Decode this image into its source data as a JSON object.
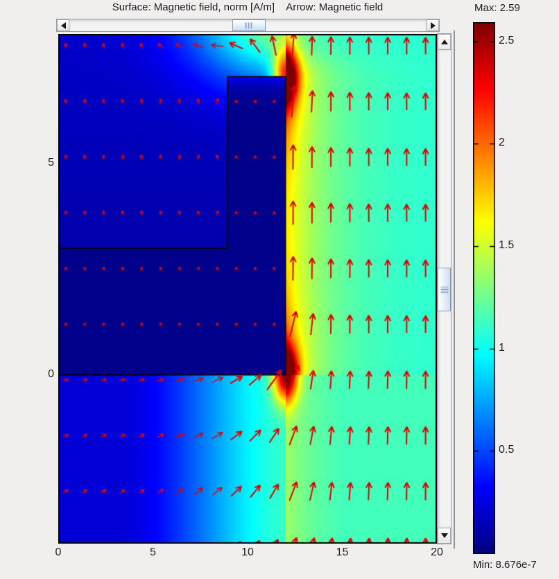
{
  "title": {
    "surface": "Surface: Magnetic field, norm [A/m]",
    "arrow": "Arrow: Magnetic field"
  },
  "colorbar": {
    "max_label": "Max: 2.59",
    "min_label": "Min: 8.676e-7",
    "vmin": 0,
    "vmax": 2.59,
    "tick_values": [
      2.5,
      2,
      1.5,
      1,
      0.5
    ],
    "tick_labels": [
      "2.5",
      "2",
      "1.5",
      "1",
      "0.5"
    ],
    "colormap": "jet"
  },
  "axes": {
    "x_range": [
      0,
      20
    ],
    "y_range": [
      -4.0,
      8.08
    ],
    "x_ticks": [
      0,
      5,
      10,
      15,
      20
    ],
    "x_tick_labels": [
      "0",
      "5",
      "10",
      "15",
      "20"
    ],
    "y_ticks": [
      5,
      0
    ],
    "y_tick_labels": [
      "5",
      "0"
    ]
  },
  "chart_data": {
    "type": "heatmap",
    "subtype": "surface-with-quiver",
    "quantity": "Magnetic field, norm [A/m]",
    "arrow_quantity": "Magnetic field",
    "colormap": "jet",
    "value_max": 2.59,
    "value_min": 8.676e-07,
    "background_field_level": 1.08,
    "core_field_level": 0.03,
    "geometry_outline": [
      [
        0,
        3
      ],
      [
        8.93,
        3
      ],
      [
        8.93,
        7.07
      ],
      [
        12,
        7.07
      ],
      [
        12,
        0
      ],
      [
        0,
        0
      ]
    ],
    "hotspots": [
      {
        "x": 12,
        "y": 7.07,
        "value": 2.59
      },
      {
        "x": 12,
        "y": 0,
        "value": 2.59
      }
    ],
    "sample_x": [
      1,
      5,
      9,
      11,
      13,
      16,
      20
    ],
    "sample_y": [
      8,
      7,
      5,
      3,
      1,
      -1,
      -4
    ],
    "sample_values": [
      [
        0.3,
        0.42,
        0.78,
        1.15,
        1.3,
        1.12,
        1.03
      ],
      [
        0.25,
        0.3,
        0.05,
        0.05,
        1.95,
        1.2,
        1.05
      ],
      [
        0.14,
        0.15,
        0.05,
        0.05,
        1.55,
        1.2,
        1.06
      ],
      [
        0.12,
        0.13,
        0.05,
        0.05,
        1.45,
        1.18,
        1.06
      ],
      [
        0.05,
        0.05,
        0.05,
        0.05,
        1.5,
        1.18,
        1.06
      ],
      [
        0.23,
        0.26,
        0.42,
        0.72,
        1.15,
        1.12,
        1.08
      ],
      [
        0.22,
        0.25,
        0.4,
        0.7,
        1.1,
        1.1,
        1.08
      ]
    ],
    "arrows": {
      "color": "#e00000",
      "x_start": 0.4,
      "x_step": 1.0,
      "cols": 20,
      "y_start": 7.8,
      "y_step": -1.32,
      "rows": 10
    }
  },
  "scroll_state": {
    "horizontal_thumb_fraction": 0.46,
    "vertical_thumb_fraction": 0.46
  }
}
